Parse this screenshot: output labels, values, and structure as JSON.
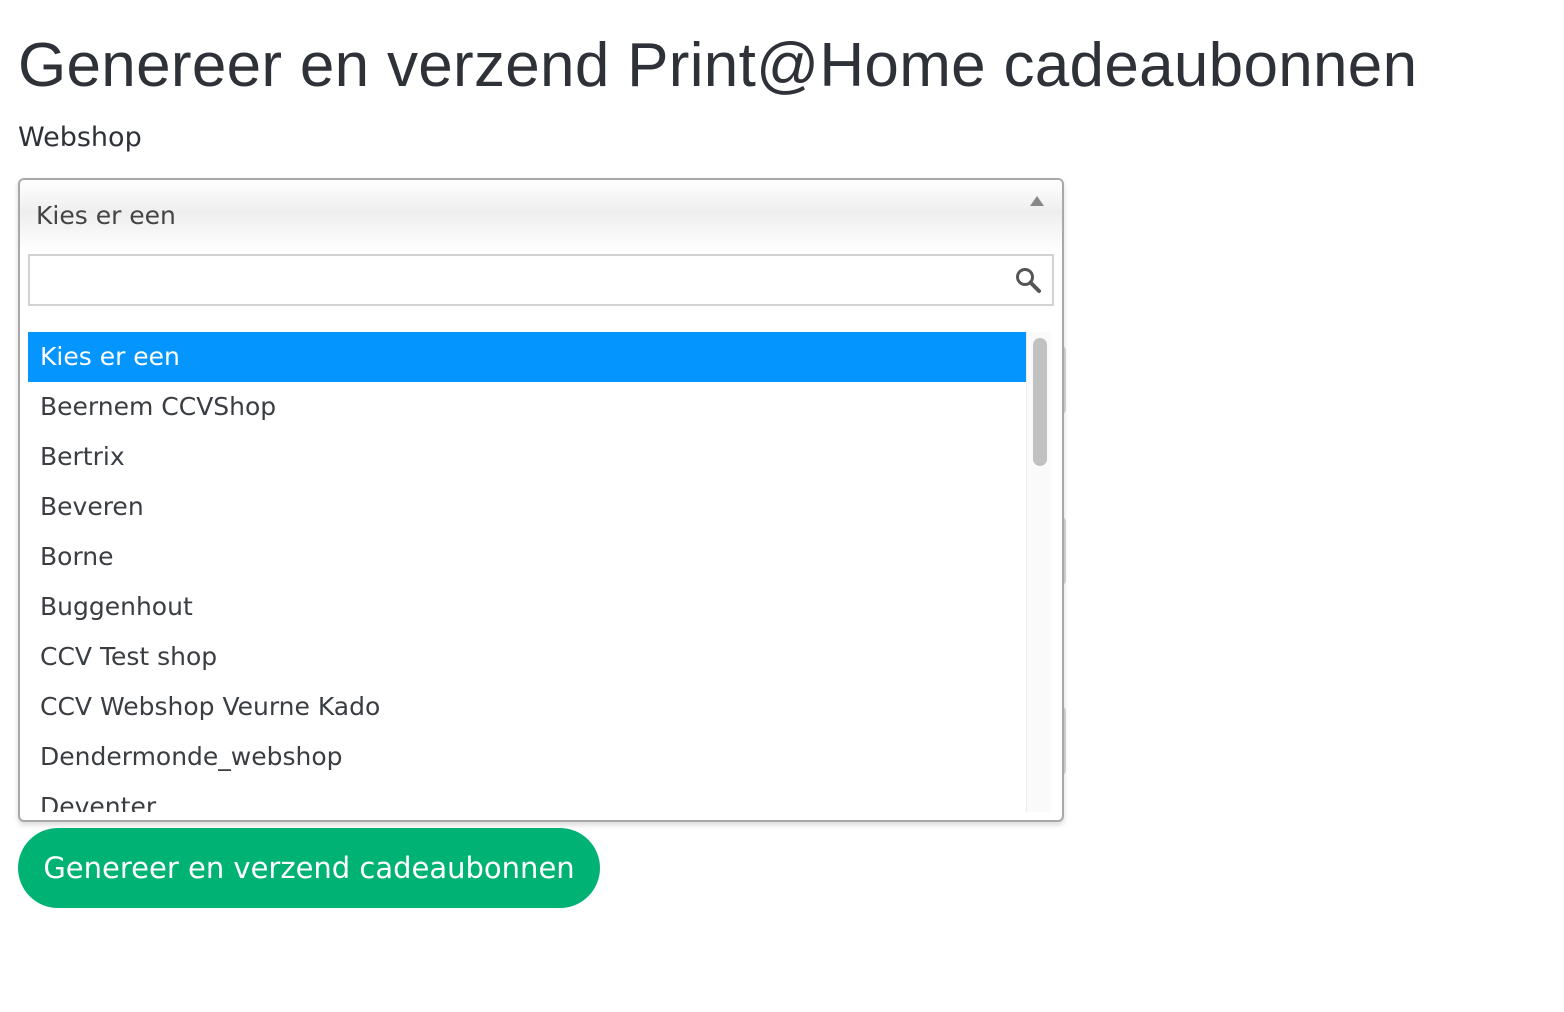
{
  "page": {
    "title": "Genereer en verzend Print@Home cadeaubonnen"
  },
  "form": {
    "webshop_label": "Webshop",
    "select": {
      "selected_value": "Kies er een",
      "search_placeholder": "",
      "options": [
        "Kies er een",
        "Beernem CCVShop",
        "Bertrix",
        "Beveren",
        "Borne",
        "Buggenhout",
        "CCV Test shop",
        "CCV Webshop Veurne Kado",
        "Dendermonde_webshop",
        "Deventer"
      ],
      "highlighted_index": 0
    },
    "submit_label": "Genereer en verzend cadeaubonnen"
  },
  "colors": {
    "highlight": "#0595ff",
    "button": "#00b274",
    "title_text": "#2e3238"
  },
  "icons": {
    "search": "search-icon",
    "dropdown_arrow": "triangle-up-icon"
  }
}
